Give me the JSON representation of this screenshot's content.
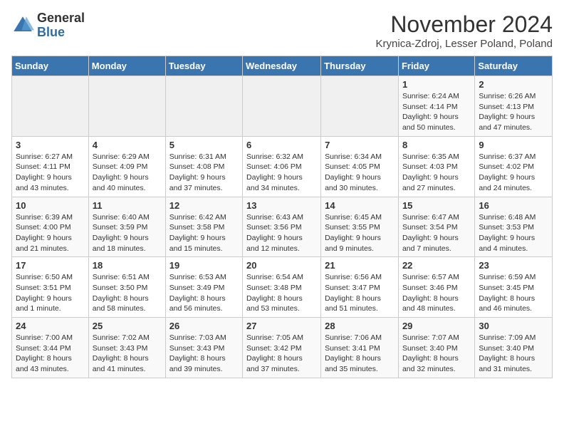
{
  "logo": {
    "general": "General",
    "blue": "Blue"
  },
  "title": "November 2024",
  "location": "Krynica-Zdroj, Lesser Poland, Poland",
  "days_of_week": [
    "Sunday",
    "Monday",
    "Tuesday",
    "Wednesday",
    "Thursday",
    "Friday",
    "Saturday"
  ],
  "weeks": [
    [
      {
        "day": "",
        "info": ""
      },
      {
        "day": "",
        "info": ""
      },
      {
        "day": "",
        "info": ""
      },
      {
        "day": "",
        "info": ""
      },
      {
        "day": "",
        "info": ""
      },
      {
        "day": "1",
        "info": "Sunrise: 6:24 AM\nSunset: 4:14 PM\nDaylight: 9 hours and 50 minutes."
      },
      {
        "day": "2",
        "info": "Sunrise: 6:26 AM\nSunset: 4:13 PM\nDaylight: 9 hours and 47 minutes."
      }
    ],
    [
      {
        "day": "3",
        "info": "Sunrise: 6:27 AM\nSunset: 4:11 PM\nDaylight: 9 hours and 43 minutes."
      },
      {
        "day": "4",
        "info": "Sunrise: 6:29 AM\nSunset: 4:09 PM\nDaylight: 9 hours and 40 minutes."
      },
      {
        "day": "5",
        "info": "Sunrise: 6:31 AM\nSunset: 4:08 PM\nDaylight: 9 hours and 37 minutes."
      },
      {
        "day": "6",
        "info": "Sunrise: 6:32 AM\nSunset: 4:06 PM\nDaylight: 9 hours and 34 minutes."
      },
      {
        "day": "7",
        "info": "Sunrise: 6:34 AM\nSunset: 4:05 PM\nDaylight: 9 hours and 30 minutes."
      },
      {
        "day": "8",
        "info": "Sunrise: 6:35 AM\nSunset: 4:03 PM\nDaylight: 9 hours and 27 minutes."
      },
      {
        "day": "9",
        "info": "Sunrise: 6:37 AM\nSunset: 4:02 PM\nDaylight: 9 hours and 24 minutes."
      }
    ],
    [
      {
        "day": "10",
        "info": "Sunrise: 6:39 AM\nSunset: 4:00 PM\nDaylight: 9 hours and 21 minutes."
      },
      {
        "day": "11",
        "info": "Sunrise: 6:40 AM\nSunset: 3:59 PM\nDaylight: 9 hours and 18 minutes."
      },
      {
        "day": "12",
        "info": "Sunrise: 6:42 AM\nSunset: 3:58 PM\nDaylight: 9 hours and 15 minutes."
      },
      {
        "day": "13",
        "info": "Sunrise: 6:43 AM\nSunset: 3:56 PM\nDaylight: 9 hours and 12 minutes."
      },
      {
        "day": "14",
        "info": "Sunrise: 6:45 AM\nSunset: 3:55 PM\nDaylight: 9 hours and 9 minutes."
      },
      {
        "day": "15",
        "info": "Sunrise: 6:47 AM\nSunset: 3:54 PM\nDaylight: 9 hours and 7 minutes."
      },
      {
        "day": "16",
        "info": "Sunrise: 6:48 AM\nSunset: 3:53 PM\nDaylight: 9 hours and 4 minutes."
      }
    ],
    [
      {
        "day": "17",
        "info": "Sunrise: 6:50 AM\nSunset: 3:51 PM\nDaylight: 9 hours and 1 minute."
      },
      {
        "day": "18",
        "info": "Sunrise: 6:51 AM\nSunset: 3:50 PM\nDaylight: 8 hours and 58 minutes."
      },
      {
        "day": "19",
        "info": "Sunrise: 6:53 AM\nSunset: 3:49 PM\nDaylight: 8 hours and 56 minutes."
      },
      {
        "day": "20",
        "info": "Sunrise: 6:54 AM\nSunset: 3:48 PM\nDaylight: 8 hours and 53 minutes."
      },
      {
        "day": "21",
        "info": "Sunrise: 6:56 AM\nSunset: 3:47 PM\nDaylight: 8 hours and 51 minutes."
      },
      {
        "day": "22",
        "info": "Sunrise: 6:57 AM\nSunset: 3:46 PM\nDaylight: 8 hours and 48 minutes."
      },
      {
        "day": "23",
        "info": "Sunrise: 6:59 AM\nSunset: 3:45 PM\nDaylight: 8 hours and 46 minutes."
      }
    ],
    [
      {
        "day": "24",
        "info": "Sunrise: 7:00 AM\nSunset: 3:44 PM\nDaylight: 8 hours and 43 minutes."
      },
      {
        "day": "25",
        "info": "Sunrise: 7:02 AM\nSunset: 3:43 PM\nDaylight: 8 hours and 41 minutes."
      },
      {
        "day": "26",
        "info": "Sunrise: 7:03 AM\nSunset: 3:43 PM\nDaylight: 8 hours and 39 minutes."
      },
      {
        "day": "27",
        "info": "Sunrise: 7:05 AM\nSunset: 3:42 PM\nDaylight: 8 hours and 37 minutes."
      },
      {
        "day": "28",
        "info": "Sunrise: 7:06 AM\nSunset: 3:41 PM\nDaylight: 8 hours and 35 minutes."
      },
      {
        "day": "29",
        "info": "Sunrise: 7:07 AM\nSunset: 3:40 PM\nDaylight: 8 hours and 32 minutes."
      },
      {
        "day": "30",
        "info": "Sunrise: 7:09 AM\nSunset: 3:40 PM\nDaylight: 8 hours and 31 minutes."
      }
    ]
  ]
}
